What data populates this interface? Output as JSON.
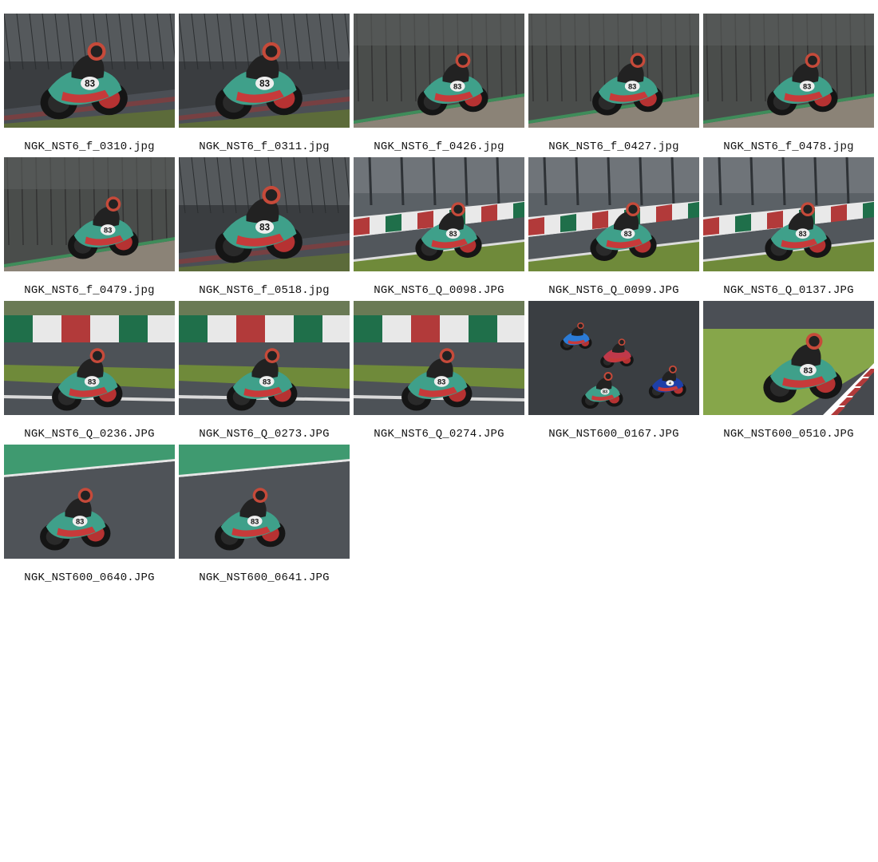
{
  "gallery": {
    "items": [
      {
        "filename": "NGK_NST6_f_0310.jpg",
        "bib": "83",
        "scene": "a"
      },
      {
        "filename": "NGK_NST6_f_0311.jpg",
        "bib": "83",
        "scene": "a"
      },
      {
        "filename": "NGK_NST6_f_0426.jpg",
        "bib": "83",
        "scene": "b"
      },
      {
        "filename": "NGK_NST6_f_0427.jpg",
        "bib": "83",
        "scene": "b"
      },
      {
        "filename": "NGK_NST6_f_0478.jpg",
        "bib": "83",
        "scene": "b"
      },
      {
        "filename": "NGK_NST6_f_0479.jpg",
        "bib": "83",
        "scene": "b"
      },
      {
        "filename": "NGK_NST6_f_0518.jpg",
        "bib": "83",
        "scene": "a"
      },
      {
        "filename": "NGK_NST6_Q_0098.JPG",
        "bib": "83",
        "scene": "c"
      },
      {
        "filename": "NGK_NST6_Q_0099.JPG",
        "bib": "83",
        "scene": "c"
      },
      {
        "filename": "NGK_NST6_Q_0137.JPG",
        "bib": "83",
        "scene": "c"
      },
      {
        "filename": "NGK_NST6_Q_0236.JPG",
        "bib": "83",
        "scene": "d"
      },
      {
        "filename": "NGK_NST6_Q_0273.JPG",
        "bib": "83",
        "scene": "d"
      },
      {
        "filename": "NGK_NST6_Q_0274.JPG",
        "bib": "83",
        "scene": "d"
      },
      {
        "filename": "NGK_NST600_0167.JPG",
        "bib": "83",
        "scene": "e"
      },
      {
        "filename": "NGK_NST600_0510.JPG",
        "bib": "83",
        "scene": "f"
      },
      {
        "filename": "NGK_NST600_0640.JPG",
        "bib": "83",
        "scene": "g"
      },
      {
        "filename": "NGK_NST600_0641.JPG",
        "bib": "83",
        "scene": "g"
      }
    ]
  },
  "colors": {
    "page_background": "#ffffff",
    "caption_text": "#111111",
    "bike_teal": "#3fa08a",
    "track_asphalt": "#4b4f55",
    "grass": "#6f8a3a",
    "kerb_red": "#b23a3a",
    "wall_green": "#1f6f4a"
  }
}
